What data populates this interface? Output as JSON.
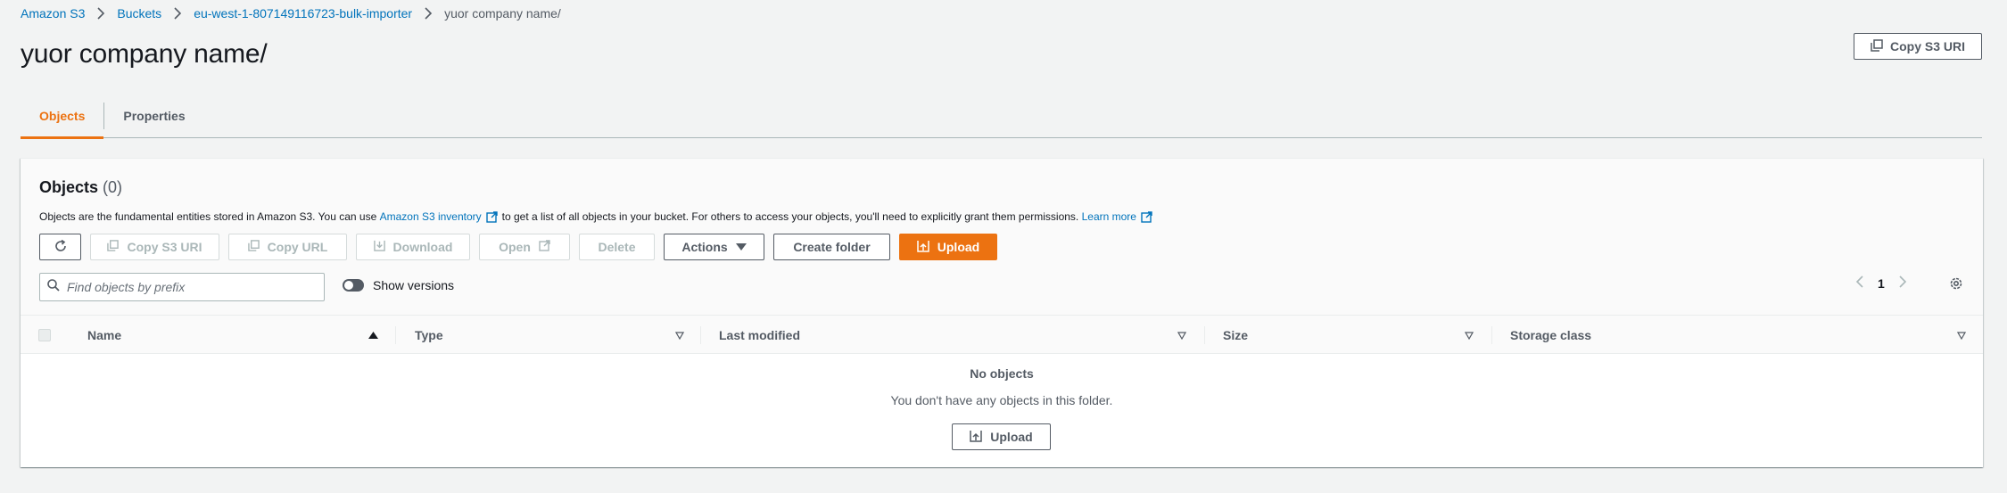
{
  "breadcrumb": {
    "items": [
      "Amazon S3",
      "Buckets",
      "eu-west-1-807149116723-bulk-importer"
    ],
    "current": "yuor company name/"
  },
  "page": {
    "title": "yuor company name/",
    "copy_uri_label": "Copy S3 URI"
  },
  "tabs": [
    {
      "label": "Objects",
      "active": true
    },
    {
      "label": "Properties",
      "active": false
    }
  ],
  "objects_panel": {
    "title": "Objects",
    "count": "(0)",
    "description_pre": "Objects are the fundamental entities stored in Amazon S3. You can use",
    "inventory_link": "Amazon S3 inventory",
    "description_mid": "to get a list of all objects in your bucket. For others to access your objects, you'll need to explicitly grant them permissions.",
    "learn_more": "Learn more"
  },
  "toolbar": {
    "copy_s3_uri": "Copy S3 URI",
    "copy_url": "Copy URL",
    "download": "Download",
    "open": "Open",
    "delete": "Delete",
    "actions": "Actions",
    "create_folder": "Create folder",
    "upload": "Upload"
  },
  "search": {
    "placeholder": "Find objects by prefix",
    "value": ""
  },
  "versions_toggle": {
    "label": "Show versions",
    "on": false
  },
  "pagination": {
    "page": "1"
  },
  "table": {
    "columns": [
      "Name",
      "Type",
      "Last modified",
      "Size",
      "Storage class"
    ]
  },
  "empty_state": {
    "title": "No objects",
    "description": "You don't have any objects in this folder.",
    "upload": "Upload"
  },
  "colors": {
    "accent": "#ec7211",
    "link": "#0073bb",
    "text": "#16191f",
    "muted": "#545b64"
  }
}
